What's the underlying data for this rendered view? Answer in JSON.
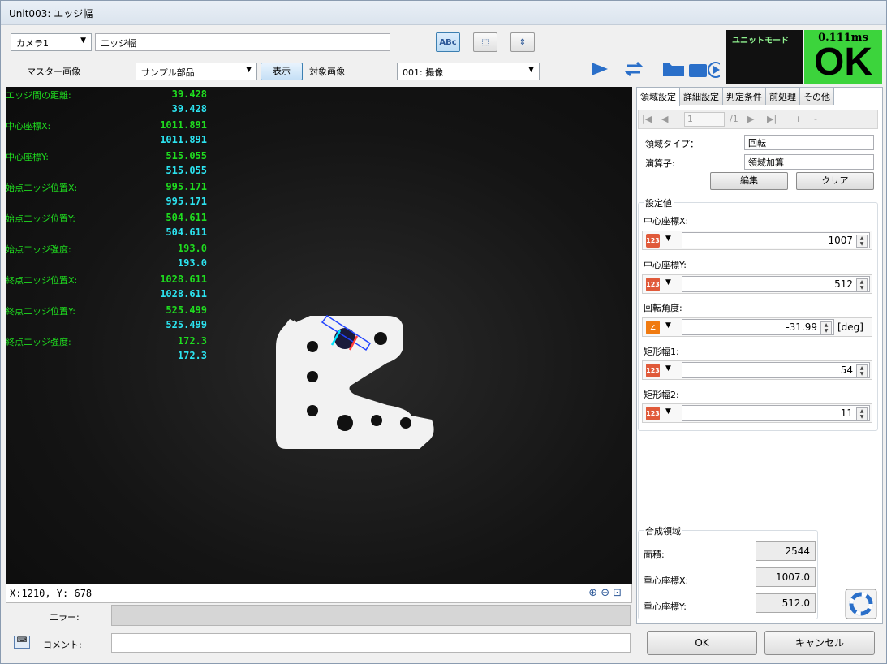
{
  "window": {
    "title": "Unit003: エッジ幅"
  },
  "toolbar": {
    "camera_select": "カメラ1",
    "unit_name": "エッジ幅",
    "master_image_label": "マスター画像",
    "master_image_select": "サンプル部品",
    "show_button": "表示",
    "target_image_label": "対象画像",
    "target_image_select": "001: 撮像",
    "tool_buttons": [
      "ABc",
      "⬚",
      "⇕"
    ]
  },
  "status": {
    "unit_mode_label": "ユニットモード",
    "time": "0.111ms",
    "result": "OK",
    "result_color": "#3cd43c"
  },
  "measurements": [
    {
      "label": "エッジ間の距離:",
      "value_green": "39.428",
      "value_cyan": "39.428"
    },
    {
      "label": "中心座標X:",
      "value_green": "1011.891",
      "value_cyan": "1011.891"
    },
    {
      "label": "中心座標Y:",
      "value_green": "515.055",
      "value_cyan": "515.055"
    },
    {
      "label": "始点エッジ位置X:",
      "value_green": "995.171",
      "value_cyan": "995.171"
    },
    {
      "label": "始点エッジ位置Y:",
      "value_green": "504.611",
      "value_cyan": "504.611"
    },
    {
      "label": "始点エッジ強度:",
      "value_green": "193.0",
      "value_cyan": "193.0"
    },
    {
      "label": "終点エッジ位置X:",
      "value_green": "1028.611",
      "value_cyan": "1028.611"
    },
    {
      "label": "終点エッジ位置Y:",
      "value_green": "525.499",
      "value_cyan": "525.499"
    },
    {
      "label": "終点エッジ強度:",
      "value_green": "172.3",
      "value_cyan": "172.3"
    }
  ],
  "statusbar": {
    "coords": "X:1210, Y: 678"
  },
  "tabs": [
    "領域設定",
    "詳細設定",
    "判定条件",
    "前処理",
    "その他"
  ],
  "nav": {
    "current": "1",
    "total": "/1"
  },
  "region": {
    "type_label": "領域タイプ：",
    "type_value": "回転",
    "operator_label": "演算子:",
    "operator_value": "領域加算",
    "edit_button": "編集",
    "clear_button": "クリア"
  },
  "settings": {
    "title": "設定値",
    "fields": [
      {
        "label": "中心座標X:",
        "value": "1007",
        "unit": ""
      },
      {
        "label": "中心座標Y:",
        "value": "512",
        "unit": ""
      },
      {
        "label": "回転角度:",
        "value": "-31.99",
        "unit": "[deg]"
      },
      {
        "label": "矩形幅1:",
        "value": "54",
        "unit": ""
      },
      {
        "label": "矩形幅2:",
        "value": "11",
        "unit": ""
      }
    ]
  },
  "composite": {
    "title": "合成領域",
    "area_label": "面積:",
    "area_value": "2544",
    "cx_label": "重心座標X:",
    "cx_value": "1007.0",
    "cy_label": "重心座標Y:",
    "cy_value": "512.0"
  },
  "bottom": {
    "error_label": "エラー:",
    "comment_label": "コメント:",
    "ok_button": "OK",
    "cancel_button": "キャンセル"
  }
}
